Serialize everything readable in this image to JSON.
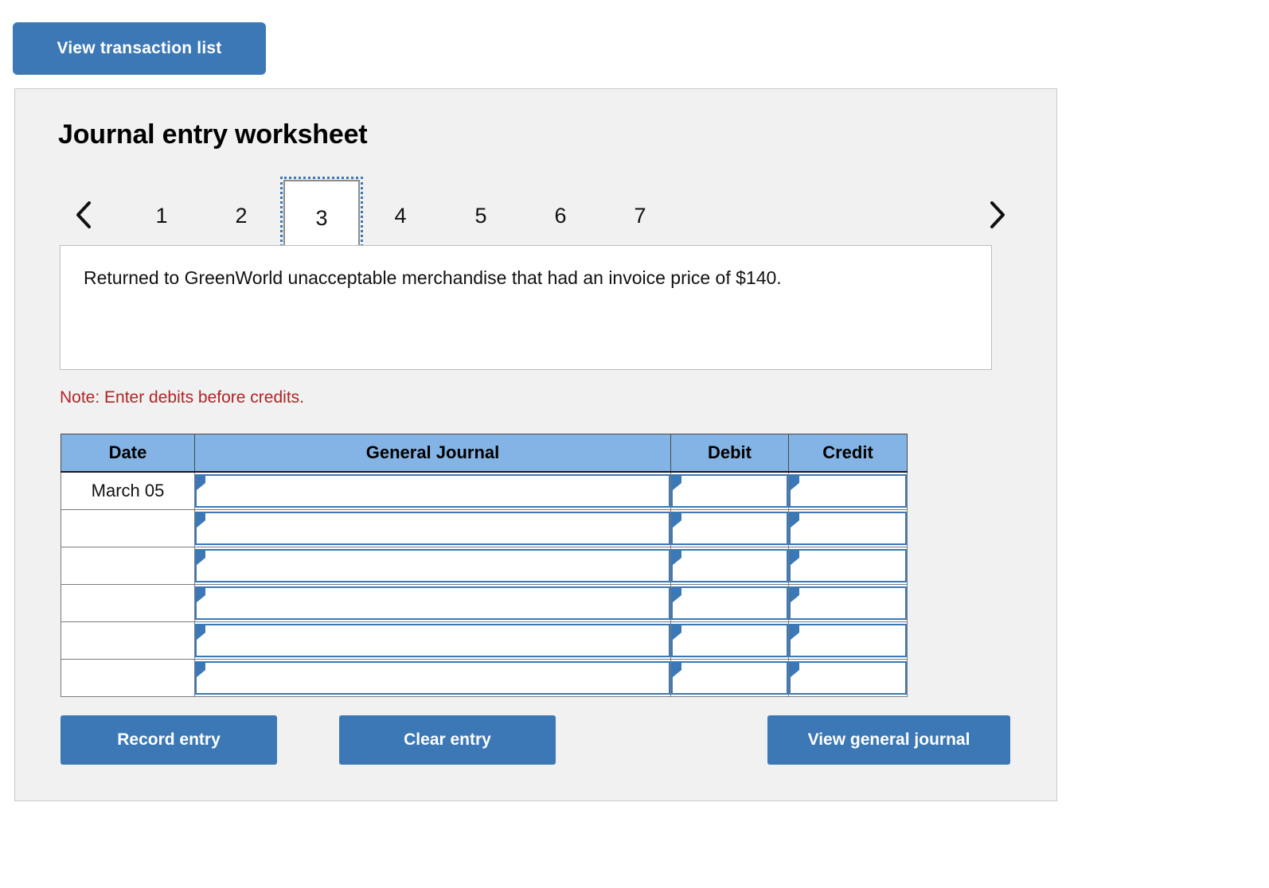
{
  "top": {
    "view_transaction_list_label": "View transaction list"
  },
  "worksheet": {
    "title": "Journal entry worksheet",
    "pager": {
      "prev_icon": "chevron-left-icon",
      "next_icon": "chevron-right-icon",
      "pages": [
        "1",
        "2",
        "3",
        "4",
        "5",
        "6",
        "7"
      ],
      "selected": "3"
    },
    "description": "Returned to GreenWorld unacceptable merchandise that had an invoice price of $140.",
    "note": "Note: Enter debits before credits.",
    "table": {
      "headers": [
        "Date",
        "General Journal",
        "Debit",
        "Credit"
      ],
      "rows": [
        {
          "date": "March 05",
          "general_journal": "",
          "debit": "",
          "credit": ""
        },
        {
          "date": "",
          "general_journal": "",
          "debit": "",
          "credit": ""
        },
        {
          "date": "",
          "general_journal": "",
          "debit": "",
          "credit": ""
        },
        {
          "date": "",
          "general_journal": "",
          "debit": "",
          "credit": ""
        },
        {
          "date": "",
          "general_journal": "",
          "debit": "",
          "credit": ""
        },
        {
          "date": "",
          "general_journal": "",
          "debit": "",
          "credit": ""
        }
      ]
    },
    "actions": {
      "record_entry_label": "Record entry",
      "clear_entry_label": "Clear entry",
      "view_general_journal_label": "View general journal"
    }
  },
  "colors": {
    "button_blue": "#3c78b5",
    "table_header_blue": "#83b4e5",
    "panel_bg": "#f1f1f1",
    "note_red": "#b02427",
    "input_border_blue": "#3c78b5"
  }
}
